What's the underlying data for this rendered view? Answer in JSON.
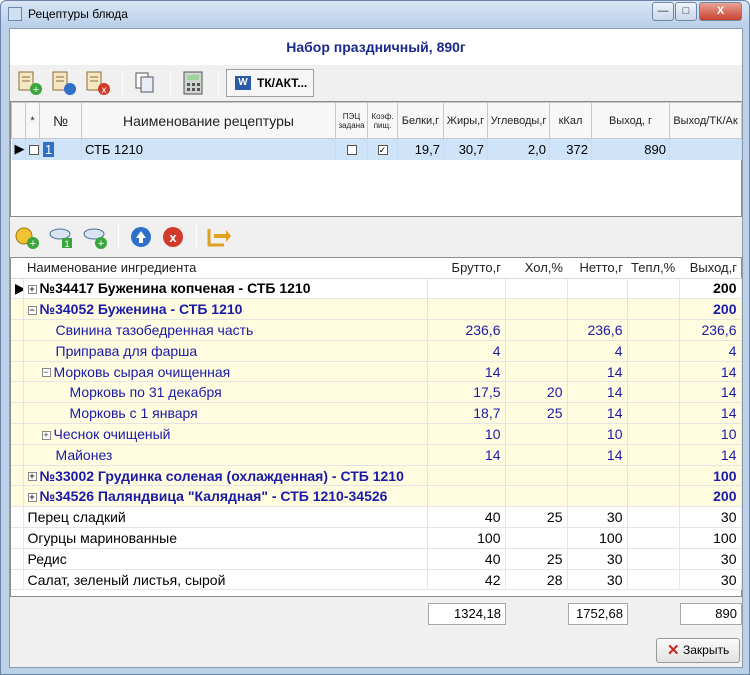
{
  "window": {
    "title": "Рецептуры блюда",
    "controls": [
      "—",
      "□",
      "X"
    ]
  },
  "header": {
    "dish_title": "Набор праздничный, 890г"
  },
  "toolbar1": {
    "tk_button_label": "ТК/АКТ..."
  },
  "recipes_table": {
    "columns": [
      "*",
      "№",
      "Наименование рецептуры",
      "ПЭЦ задана",
      "Коэф. пищ.",
      "Белки,г",
      "Жиры,г",
      "Углеводы,г",
      "кКал",
      "Выход, г",
      "Выход/ТК/Ак"
    ],
    "rows": [
      {
        "num": "1",
        "name": "СТБ 1210",
        "pec": false,
        "coef": true,
        "protein": "19,7",
        "fat": "30,7",
        "carbs": "2,0",
        "kcal": "372",
        "yield": "890",
        "yield_tk": ""
      }
    ]
  },
  "ingredients_table": {
    "columns": [
      "Наименование ингредиента",
      "Брутто,г",
      "Хол,%",
      "Нетто,г",
      "Тепл,%",
      "Выход,г"
    ],
    "rows": [
      {
        "name": "№34417 Буженина  копченая - СТБ 1210",
        "brutto": "",
        "hol": "",
        "netto": "",
        "tepl": "",
        "vyhod": "200"
      },
      {
        "name": "№34052 Буженина - СТБ 1210",
        "brutto": "",
        "hol": "",
        "netto": "",
        "tepl": "",
        "vyhod": "200"
      },
      {
        "name": "Свинина тазобедренная часть",
        "brutto": "236,6",
        "hol": "",
        "netto": "236,6",
        "tepl": "",
        "vyhod": "236,6"
      },
      {
        "name": "Приправа для фарша",
        "brutto": "4",
        "hol": "",
        "netto": "4",
        "tepl": "",
        "vyhod": "4"
      },
      {
        "name": "Морковь сырая очищенная",
        "brutto": "14",
        "hol": "",
        "netto": "14",
        "tepl": "",
        "vyhod": "14"
      },
      {
        "name": "Морковь   по 31 декабря",
        "brutto": "17,5",
        "hol": "20",
        "netto": "14",
        "tepl": "",
        "vyhod": "14"
      },
      {
        "name": "Морковь  с 1 января",
        "brutto": "18,7",
        "hol": "25",
        "netto": "14",
        "tepl": "",
        "vyhod": "14"
      },
      {
        "name": "Чеснок очищеный",
        "brutto": "10",
        "hol": "",
        "netto": "10",
        "tepl": "",
        "vyhod": "10"
      },
      {
        "name": "Майонез",
        "brutto": "14",
        "hol": "",
        "netto": "14",
        "tepl": "",
        "vyhod": "14"
      },
      {
        "name": "№33002 Грудинка соленая (охлажденная) - СТБ 1210",
        "brutto": "",
        "hol": "",
        "netto": "",
        "tepl": "",
        "vyhod": "100"
      },
      {
        "name": "№34526 Паляндвица \"Калядная\" - СТБ 1210-34526",
        "brutto": "",
        "hol": "",
        "netto": "",
        "tepl": "",
        "vyhod": "200"
      },
      {
        "name": "Перец сладкий",
        "brutto": "40",
        "hol": "25",
        "netto": "30",
        "tepl": "",
        "vyhod": "30"
      },
      {
        "name": "Огурцы маринованные",
        "brutto": "100",
        "hol": "",
        "netto": "100",
        "tepl": "",
        "vyhod": "100"
      },
      {
        "name": "Редис",
        "brutto": "40",
        "hol": "25",
        "netto": "30",
        "tepl": "",
        "vyhod": "30"
      },
      {
        "name": "Салат, зеленый листья, сырой",
        "brutto": "42",
        "hol": "28",
        "netto": "30",
        "tepl": "",
        "vyhod": "30"
      }
    ]
  },
  "totals": {
    "brutto": "1324,18",
    "netto": "1752,68",
    "vyhod": "890"
  },
  "close_button": {
    "label": "Закрыть"
  }
}
